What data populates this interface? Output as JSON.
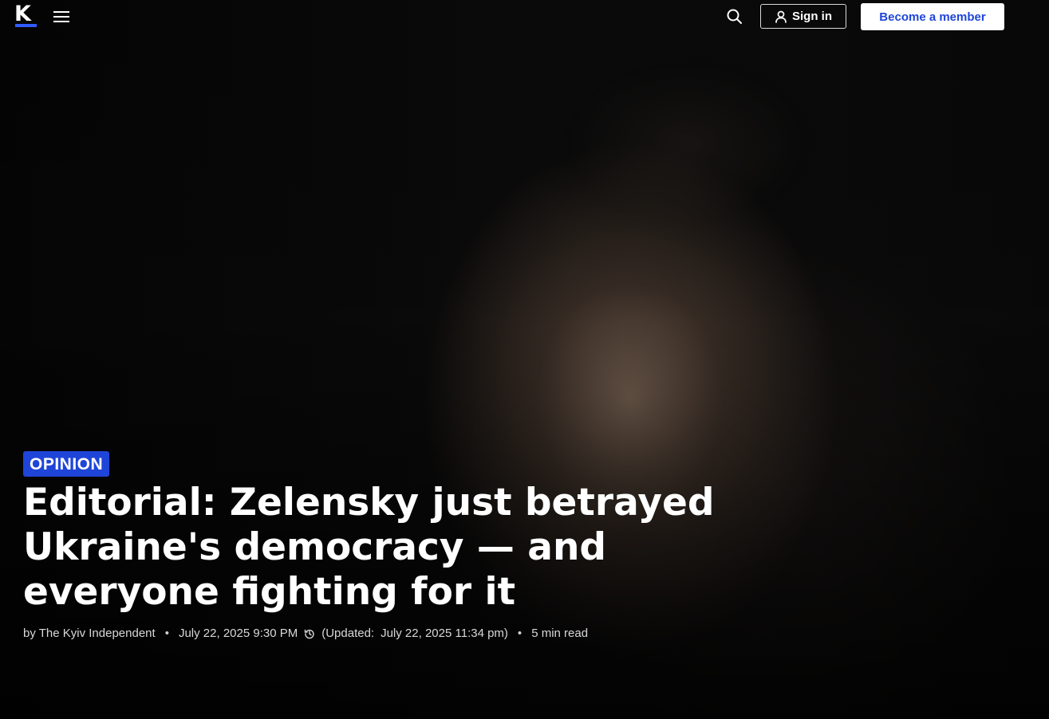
{
  "brand": {
    "logo_letter": "K",
    "accent": "#1f45d8"
  },
  "header": {
    "sign_in_label": "Sign in",
    "become_member_label": "Become a member",
    "icons": [
      "menu-icon",
      "search-icon",
      "user-icon"
    ]
  },
  "article": {
    "category": "OPINION",
    "title": "Editorial: Zelensky just betrayed Ukraine's democracy — and everyone fighting for it",
    "byline": "by The Kyiv Independent",
    "published": "July 22, 2025 9:30 PM",
    "updated_prefix": "(Updated:",
    "updated": "July 22, 2025 11:34 pm)",
    "read_time": "5 min read"
  }
}
